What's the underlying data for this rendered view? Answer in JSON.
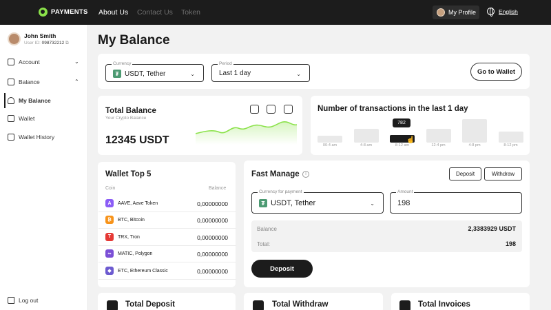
{
  "header": {
    "logo": "PAYMENTS",
    "nav": [
      "About Us",
      "Contact Us",
      "Token"
    ],
    "profile": "My Profile",
    "language": "English"
  },
  "user": {
    "name": "John Smith",
    "id_label": "User ID:",
    "id": "098732212"
  },
  "sidebar": {
    "items": [
      {
        "label": "Account"
      },
      {
        "label": "Balance"
      },
      {
        "label": "My Balance"
      },
      {
        "label": "Wallet"
      },
      {
        "label": "Wallet History"
      }
    ],
    "logout": "Log out"
  },
  "page": {
    "title": "My Balance"
  },
  "filters": {
    "currency_label": "Currency",
    "currency": "USDT, Tether",
    "period_label": "Period",
    "period": "Last 1 day",
    "go_wallet": "Go to Wallet"
  },
  "total_balance": {
    "title": "Total Balance",
    "subtitle": "Your Crypto Balance",
    "value": "12345 USDT"
  },
  "transactions": {
    "title": "Number of transactions in the last 1 day",
    "tooltip": "782",
    "labels": [
      "00-4 am",
      "4-8 am",
      "8-12 am",
      "12-4 pm",
      "4-8 pm",
      "8-12 pm"
    ],
    "levels": [
      0.25,
      0.5,
      0.28,
      0.5,
      0.85,
      0.4
    ],
    "active_index": 2
  },
  "wallet_top": {
    "title": "Wallet Top 5",
    "col_coin": "Coin",
    "col_balance": "Balance",
    "rows": [
      {
        "icon": "A",
        "name": "AAVE, Aave Token",
        "balance": "0,00000000",
        "color": "#8b5cf6"
      },
      {
        "icon": "₿",
        "name": "BTC, Bitcoin",
        "balance": "0,00000000",
        "color": "#f7931a"
      },
      {
        "icon": "T",
        "name": "TRX, Tron",
        "balance": "0,00000000",
        "color": "#e53935"
      },
      {
        "icon": "∞",
        "name": "MATIC, Polygon",
        "balance": "0,00000000",
        "color": "#7b4fd6"
      },
      {
        "icon": "◆",
        "name": "ETC, Ethereum Classic",
        "balance": "0,00000000",
        "color": "#6d5bd0"
      }
    ]
  },
  "fast_manage": {
    "title": "Fast Manage",
    "deposit_tab": "Deposit",
    "withdraw_tab": "Withdraw",
    "currency_label": "Currency for payment",
    "currency": "USDT, Tether",
    "amount_label": "Amount",
    "amount": "198",
    "balance_label": "Balance",
    "balance": "2,3383929 USDT",
    "total_label": "Total:",
    "total": "198",
    "submit": "Deposit"
  },
  "bottom": {
    "deposit": "Total Deposit",
    "withdraw": "Total Withdraw",
    "invoices": "Total Invoices"
  },
  "colors": {
    "accent": "#8be24a",
    "dark": "#1c1c1c"
  }
}
